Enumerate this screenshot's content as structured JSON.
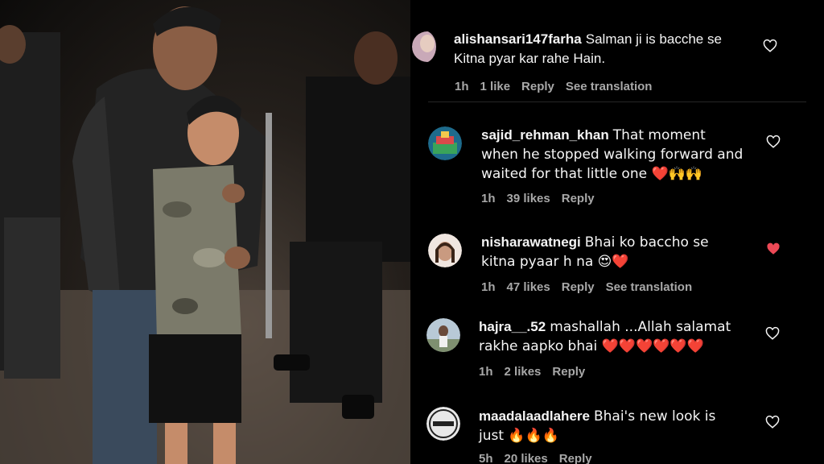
{
  "comments": [
    {
      "username": "alishansari147farha",
      "text": "Salman ji is bacche se Kitna pyar kar rahe Hain.",
      "time": "1h",
      "likes": "1 like",
      "reply": "Reply",
      "translate": "See translation",
      "liked": false,
      "avatar_color": "#c9a9b8"
    },
    {
      "username": "sajid_rehman_khan",
      "text": "That moment when he stopped walking forward and waited for that little one ❤️🙌🙌",
      "time": "1h",
      "likes": "39 likes",
      "reply": "Reply",
      "liked": false,
      "avatar_color": "#3aa35a"
    },
    {
      "username": "nisharawatnegi",
      "text": "Bhai ko baccho se kitna pyaar h na 😍❤️",
      "time": "1h",
      "likes": "47 likes",
      "reply": "Reply",
      "translate": "See translation",
      "liked": true,
      "avatar_color": "#b58c78"
    },
    {
      "username": "hajra__.52",
      "text": "mashallah ...Allah salamat rakhe aapko bhai ❤️❤️❤️❤️❤️❤️",
      "time": "1h",
      "likes": "2 likes",
      "reply": "Reply",
      "liked": false,
      "avatar_color": "#8aa3b5"
    },
    {
      "username": "maadalaadlahere",
      "text": "Bhai's new look is just 🔥🔥🔥",
      "time": "5h",
      "likes": "20 likes",
      "reply": "Reply",
      "liked": false,
      "avatar_color": "#e8e8e8",
      "avatar_text": "MAA DA LAADLA"
    }
  ],
  "colors": {
    "background": "#000000",
    "text": "#f5f5f5",
    "meta": "#a8a8a8",
    "liked_heart": "#ed4956"
  }
}
